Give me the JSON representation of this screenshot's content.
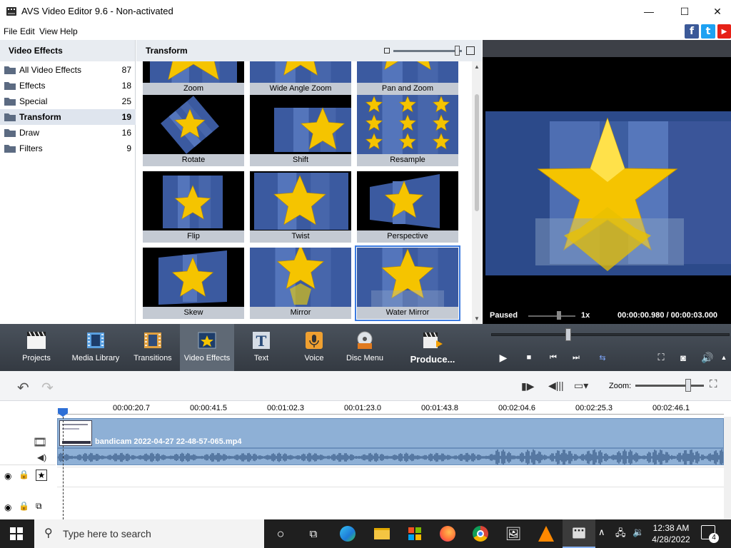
{
  "window": {
    "title": "AVS Video Editor 9.6 - Non-activated",
    "minimize_glyph": "—",
    "maximize_glyph": "☐",
    "close_glyph": "✕"
  },
  "menu": [
    "File",
    "Edit",
    "View",
    "Help"
  ],
  "social": [
    {
      "name": "facebook-icon",
      "glyph": "f",
      "color": "#3b5998"
    },
    {
      "name": "twitter-icon",
      "glyph": "t",
      "color": "#1da1f2"
    },
    {
      "name": "youtube-icon",
      "glyph": "▶",
      "color": "#e62117"
    }
  ],
  "categories": {
    "header": "Video Effects",
    "items": [
      {
        "label": "All Video Effects",
        "count": "87"
      },
      {
        "label": "Effects",
        "count": "18"
      },
      {
        "label": "Special",
        "count": "25"
      },
      {
        "label": "Transform",
        "count": "19",
        "active": true
      },
      {
        "label": "Draw",
        "count": "16"
      },
      {
        "label": "Filters",
        "count": "9"
      }
    ]
  },
  "gallery": {
    "header": "Transform",
    "tiles": [
      "Zoom",
      "Wide Angle Zoom",
      "Pan and Zoom",
      "Rotate",
      "Shift",
      "Resample",
      "Flip",
      "Twist",
      "Perspective",
      "Skew",
      "Mirror",
      "Water Mirror"
    ],
    "selected": "Water Mirror"
  },
  "preview": {
    "status": "Paused",
    "speed": "1x",
    "time": "00:00:00.980 / 00:00:03.000"
  },
  "toolbar": {
    "items": [
      "Projects",
      "Media Library",
      "Transitions",
      "Video Effects",
      "Text",
      "Voice",
      "Disc Menu",
      "Produce..."
    ],
    "active": "Video Effects"
  },
  "timeline": {
    "zoom_label": "Zoom:",
    "ruler": [
      "00:00:20.7",
      "00:00:41.5",
      "00:01:02.3",
      "00:01:23.0",
      "00:01:43.8",
      "00:02:04.6",
      "00:02:25.3",
      "00:02:46.1"
    ],
    "clip_name": "bandicam 2022-04-27 22-48-57-065.mp4"
  },
  "taskbar": {
    "search_placeholder": "Type here to search",
    "time": "12:38 AM",
    "date": "4/28/2022",
    "notifications": "4"
  }
}
